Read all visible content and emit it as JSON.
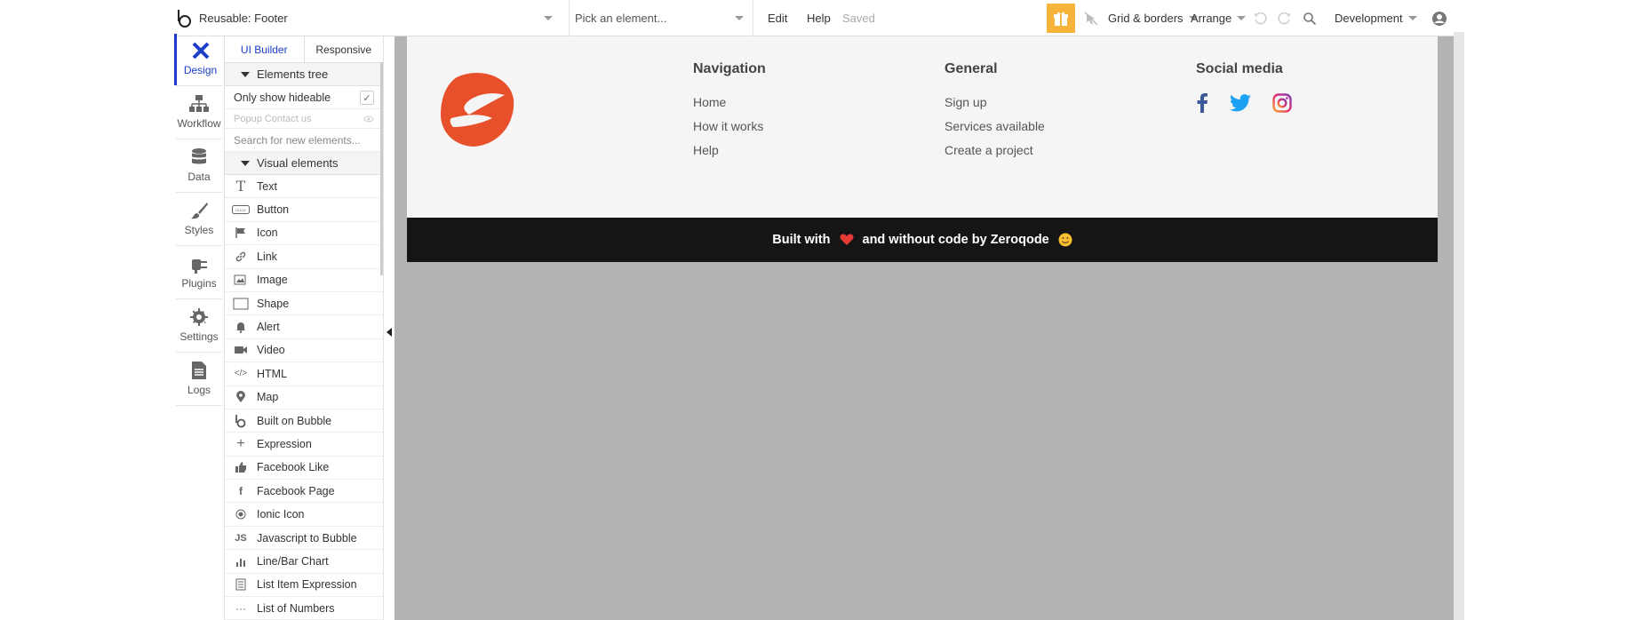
{
  "topbar": {
    "page_name": "Reusable: Footer",
    "pick_placeholder": "Pick an element...",
    "edit": "Edit",
    "help": "Help",
    "saved": "Saved",
    "grid": "Grid & borders",
    "arrange": "Arrange",
    "environment": "Development"
  },
  "leftnav": {
    "design": "Design",
    "workflow": "Workflow",
    "data": "Data",
    "styles": "Styles",
    "plugins": "Plugins",
    "settings": "Settings",
    "logs": "Logs"
  },
  "panel": {
    "tab_builder": "UI Builder",
    "tab_responsive": "Responsive",
    "elements_tree": "Elements tree",
    "only_hideable": "Only show hideable",
    "popup_item": "Popup Contact us",
    "search_placeholder": "Search for new elements...",
    "visual_elements": "Visual elements",
    "items": [
      {
        "label": "Text"
      },
      {
        "label": "Button"
      },
      {
        "label": "Icon"
      },
      {
        "label": "Link"
      },
      {
        "label": "Image"
      },
      {
        "label": "Shape"
      },
      {
        "label": "Alert"
      },
      {
        "label": "Video"
      },
      {
        "label": "HTML"
      },
      {
        "label": "Map"
      },
      {
        "label": "Built on Bubble"
      },
      {
        "label": "Expression"
      },
      {
        "label": "Facebook Like"
      },
      {
        "label": "Facebook Page"
      },
      {
        "label": "Ionic Icon"
      },
      {
        "label": "Javascript to Bubble"
      },
      {
        "label": "Line/Bar Chart"
      },
      {
        "label": "List Item Expression"
      },
      {
        "label": "List of Numbers"
      }
    ]
  },
  "footer": {
    "nav_title": "Navigation",
    "nav_links": [
      "Home",
      "How it works",
      "Help"
    ],
    "general_title": "General",
    "general_links": [
      "Sign up",
      "Services available",
      "Create a project"
    ],
    "social_title": "Social media",
    "bar_text_1": "Built with",
    "bar_text_2": "and without code by Zeroqode",
    "colors": {
      "brand": "#e8502b",
      "bar": "#151515",
      "facebook": "#3b5998",
      "twitter": "#1da1f2",
      "accent": "#1a3ec8"
    }
  }
}
